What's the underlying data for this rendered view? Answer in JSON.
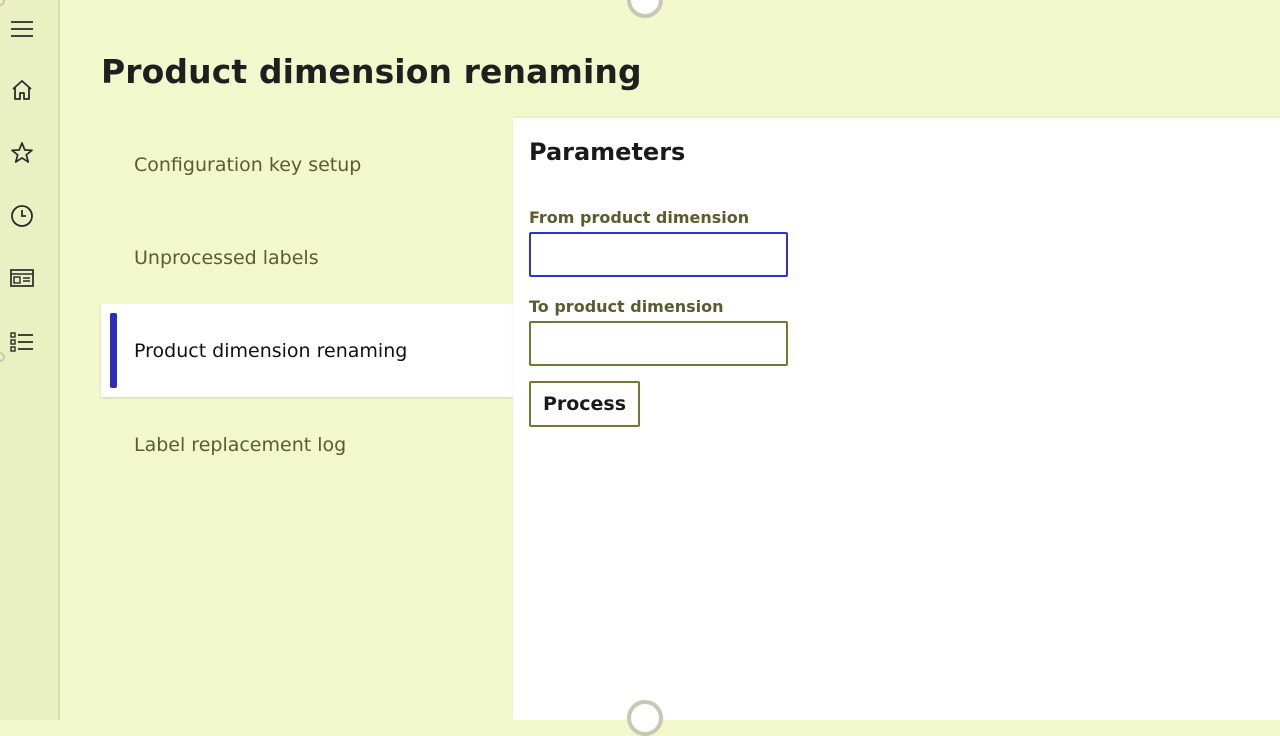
{
  "nav_rail": {
    "items": [
      {
        "name": "menu",
        "icon": "hamburger-menu-icon"
      },
      {
        "name": "home",
        "icon": "home-icon"
      },
      {
        "name": "favorites",
        "icon": "star-icon"
      },
      {
        "name": "recent",
        "icon": "clock-icon"
      },
      {
        "name": "workspaces",
        "icon": "workspace-icon"
      },
      {
        "name": "modules",
        "icon": "list-icon"
      }
    ]
  },
  "page": {
    "title": "Product dimension renaming"
  },
  "left_nav": {
    "items": [
      {
        "label": "Configuration key setup",
        "active": false
      },
      {
        "label": "Unprocessed labels",
        "active": false
      },
      {
        "label": "Product dimension renaming",
        "active": true
      },
      {
        "label": "Label replacement log",
        "active": false
      }
    ]
  },
  "parameters": {
    "heading": "Parameters",
    "from_label": "From product dimension",
    "from_value": "",
    "to_label": "To product dimension",
    "to_value": "",
    "process_label": "Process"
  },
  "colors": {
    "background": "#f1f8cc",
    "accent": "#2b2fb8",
    "border": "#7a7535"
  }
}
